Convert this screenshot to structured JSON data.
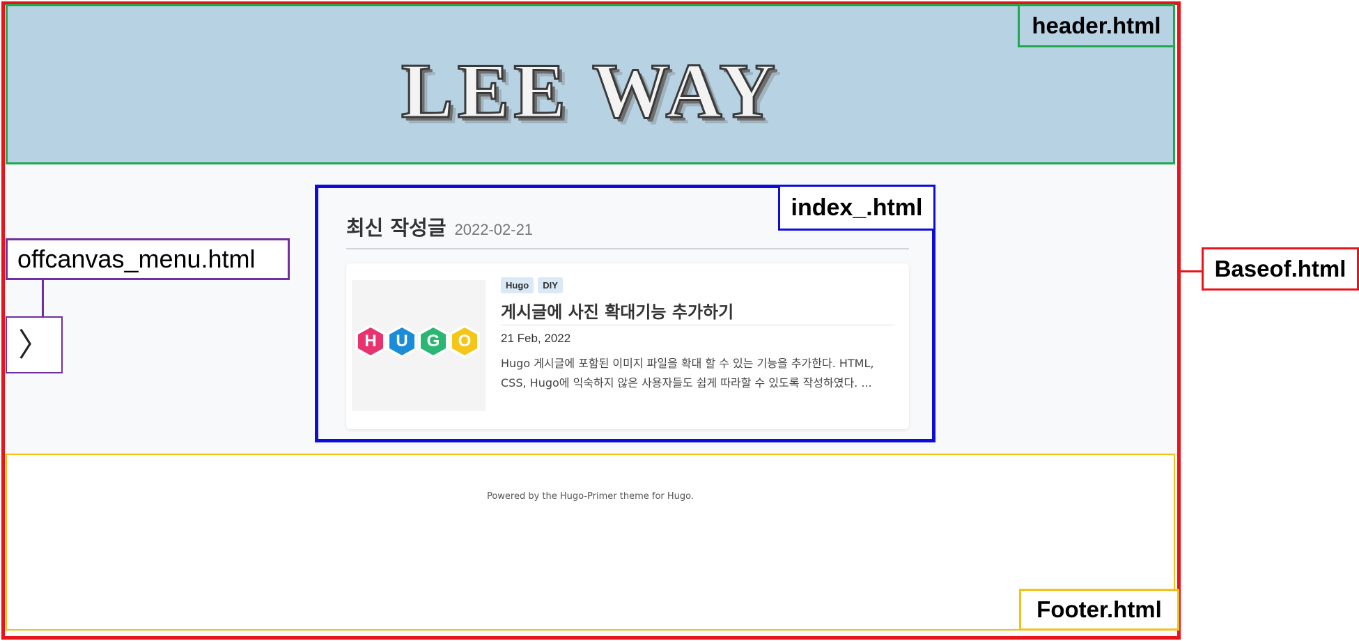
{
  "labels": {
    "header": "header.html",
    "index": "index_.html",
    "offcanvas": "offcanvas_menu.html",
    "baseof": "Baseof.html",
    "footer": "Footer.html"
  },
  "header": {
    "site_title": "LEE WAY"
  },
  "offcanvas": {
    "toggle_icon": "〉"
  },
  "index": {
    "section_title": "최신 작성글",
    "section_date": "2022-02-21",
    "post": {
      "thumbnail_letters": [
        "H",
        "U",
        "G",
        "O"
      ],
      "thumbnail_colors": [
        "#e8336f",
        "#1a8cd8",
        "#2bb673",
        "#f5c518"
      ],
      "tags": [
        "Hugo",
        "DIY"
      ],
      "title": "게시글에 사진 확대기능 추가하기",
      "date": "21 Feb, 2022",
      "summary": "Hugo 게시글에 포함된 이미지 파일을 확대 할 수 있는 기능을 추가한다. HTML, CSS, Hugo에 익숙하지 않은 사용자들도 쉽게 따라할 수 있도록 작성하였다. ..."
    }
  },
  "footer": {
    "credit": "Powered by the Hugo-Primer theme for Hugo."
  },
  "colors": {
    "baseof": "#e8141c",
    "header": "#1fa84f",
    "index": "#0d0dd6",
    "offcanvas": "#7030a0",
    "footer": "#f2c21b",
    "header_bg": "#b7d2e3"
  }
}
